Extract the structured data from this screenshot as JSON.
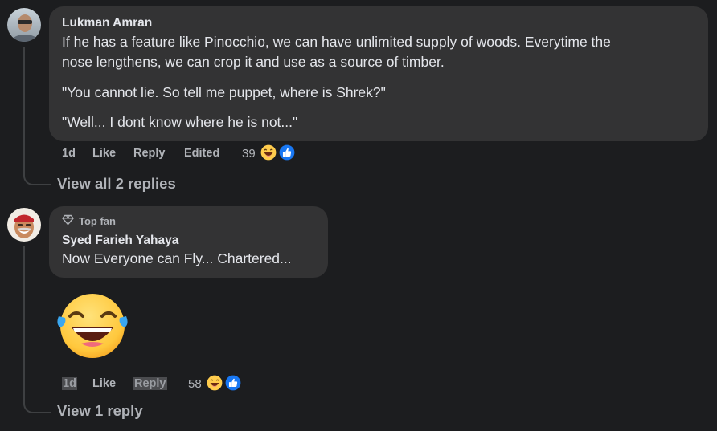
{
  "comments": [
    {
      "author": "Lukman Amran",
      "paragraphs": [
        "If he has a feature like Pinocchio, we can have unlimited supply of woods. Everytime the",
        "nose lengthens, we can crop it and use as a source of timber.",
        "\"You cannot lie. So tell me puppet, where is Shrek?\"",
        "\"Well... I dont know where he is not...\""
      ],
      "time": "1d",
      "like_label": "Like",
      "reply_label": "Reply",
      "edited_label": "Edited",
      "reaction_count": "39",
      "reactions": [
        "laughing-emoji",
        "thumbs-up-like"
      ],
      "view_replies": "View all 2 replies"
    },
    {
      "badge": "Top fan",
      "badge_icon": "diamond-icon",
      "author": "Syed Farieh Yahaya",
      "paragraphs": [
        "Now Everyone can Fly... Chartered..."
      ],
      "attachment": "tears-of-joy-emoji",
      "time": "1d",
      "like_label": "Like",
      "reply_label": "Reply",
      "reaction_count": "58",
      "reactions": [
        "laughing-emoji",
        "thumbs-up-like"
      ],
      "view_replies": "View 1 reply"
    }
  ],
  "colors": {
    "background": "#1c1d1f",
    "bubble": "#333334",
    "text_primary": "#e4e6eb",
    "text_secondary": "#b0b3b8",
    "like_blue": "#1877f2",
    "emoji_yellow": "#ffcc4d"
  }
}
